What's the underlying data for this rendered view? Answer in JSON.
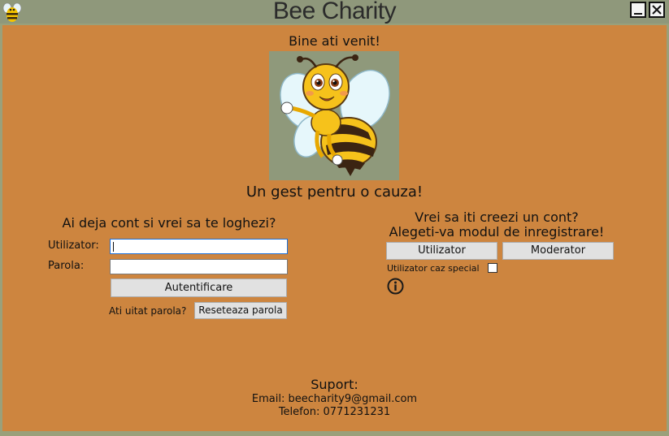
{
  "window": {
    "title": "Bee Charity",
    "minimize_label": "minimize",
    "close_label": "close"
  },
  "header": {
    "welcome": "Bine ati venit!",
    "slogan": "Un gest pentru o cauza!"
  },
  "login": {
    "heading": "Ai deja cont si vrei sa te loghezi?",
    "username_label": "Utilizator:",
    "username_value": "",
    "password_label": "Parola:",
    "password_value": "",
    "submit_label": "Autentificare",
    "forgot_text": "Ati uitat parola?",
    "reset_label": "Reseteaza parola"
  },
  "register": {
    "heading_line1": "Vrei sa iti creezi un cont?",
    "heading_line2": "Alegeti-va  modul de inregistrare!",
    "user_button": "Utilizator",
    "moderator_button": "Moderator",
    "special_label": "Utilizator caz special",
    "special_checked": false,
    "info_icon": "info-icon"
  },
  "support": {
    "title": "Suport:",
    "email": "Email: beecharity9@gmail.com",
    "phone": "Telefon: 0771231231"
  },
  "colors": {
    "background": "#cd853f",
    "titlebar": "#8f987b",
    "button": "#e1e1e1"
  }
}
